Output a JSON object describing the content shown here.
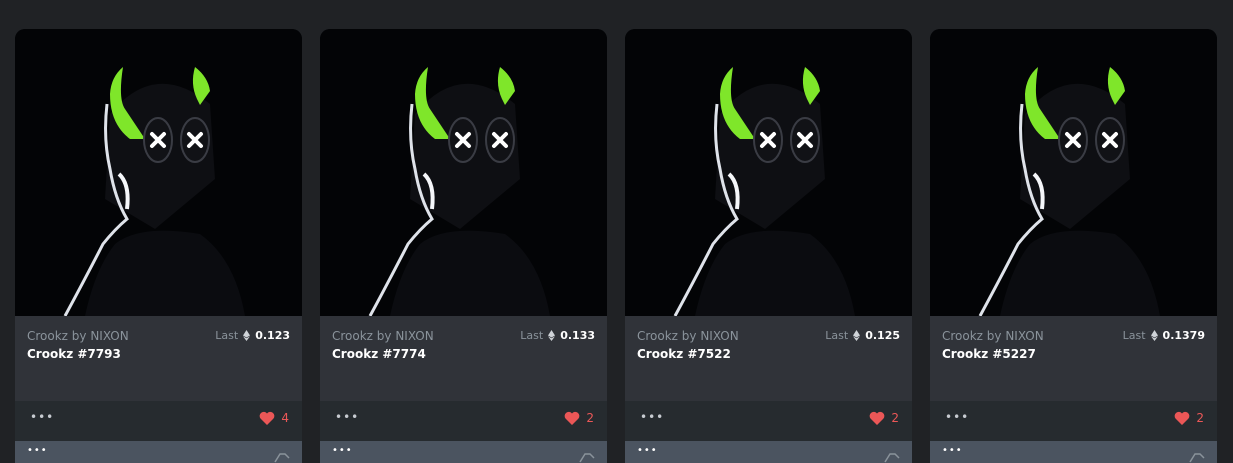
{
  "cards": [
    {
      "collection": "Crookz by NIXON",
      "name": "Crookz #7793",
      "last_label": "Last",
      "price": "0.123",
      "likes": "4"
    },
    {
      "collection": "Crookz by NIXON",
      "name": "Crookz #7774",
      "last_label": "Last",
      "price": "0.133",
      "likes": "2"
    },
    {
      "collection": "Crookz by NIXON",
      "name": "Crookz #7522",
      "last_label": "Last",
      "price": "0.125",
      "likes": "2"
    },
    {
      "collection": "Crookz by NIXON",
      "name": "Crookz #5227",
      "last_label": "Last",
      "price": "0.1379",
      "likes": "2"
    }
  ],
  "icons": {
    "currency": "ethereum-icon",
    "like": "heart-icon",
    "more": "more-dots-icon",
    "tag": "tag-icon"
  },
  "more_glyph": "•••",
  "colors": {
    "background": "#202225",
    "card": "#303339",
    "like": "#eb5757",
    "horns": "#7fe62a"
  }
}
